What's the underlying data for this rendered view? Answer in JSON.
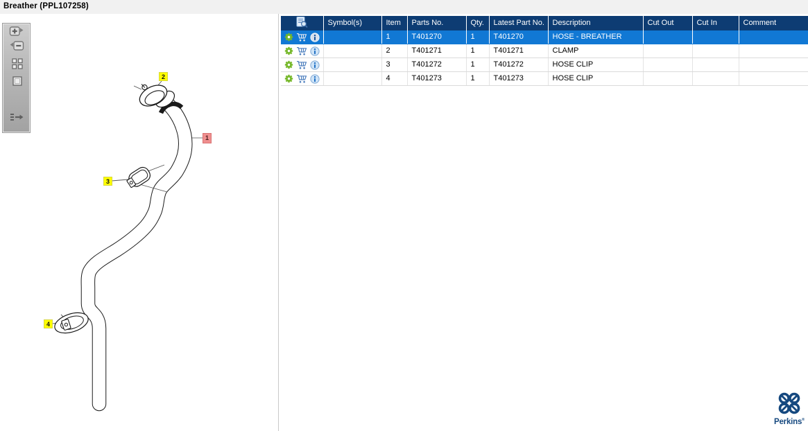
{
  "title": "Breather (PPL107258)",
  "toolbar": {
    "buttons": [
      {
        "name": "zoom-in"
      },
      {
        "name": "zoom-out"
      },
      {
        "name": "thumbnail-view"
      },
      {
        "name": "fit-view"
      },
      {
        "name": "toggle-parts-list"
      }
    ]
  },
  "table": {
    "columns": [
      "",
      "Symbol(s)",
      "Item",
      "Parts No.",
      "Qty.",
      "Latest Part No.",
      "Description",
      "Cut Out",
      "Cut In",
      "Comment"
    ],
    "rows": [
      {
        "symbols": "",
        "item": "1",
        "parts_no": "T401270",
        "qty": "1",
        "latest_part_no": "T401270",
        "description": "HOSE - BREATHER",
        "cut_out": "",
        "cut_in": "",
        "comment": "",
        "selected": true
      },
      {
        "symbols": "",
        "item": "2",
        "parts_no": "T401271",
        "qty": "1",
        "latest_part_no": "T401271",
        "description": "CLAMP",
        "cut_out": "",
        "cut_in": "",
        "comment": "",
        "selected": false
      },
      {
        "symbols": "",
        "item": "3",
        "parts_no": "T401272",
        "qty": "1",
        "latest_part_no": "T401272",
        "description": "HOSE CLIP",
        "cut_out": "",
        "cut_in": "",
        "comment": "",
        "selected": false
      },
      {
        "symbols": "",
        "item": "4",
        "parts_no": "T401273",
        "qty": "1",
        "latest_part_no": "T401273",
        "description": "HOSE CLIP",
        "cut_out": "",
        "cut_in": "",
        "comment": "",
        "selected": false
      }
    ]
  },
  "diagram": {
    "callouts": [
      {
        "label": "1",
        "state": "selected"
      },
      {
        "label": "2",
        "state": "normal"
      },
      {
        "label": "3",
        "state": "normal"
      },
      {
        "label": "4",
        "state": "normal"
      }
    ]
  },
  "branding": {
    "name": "Perkins",
    "mark": "®"
  },
  "colors": {
    "header_bg": "#0d3c73",
    "selected_row_bg": "#1178d4",
    "callout_normal": "#ffff00",
    "callout_selected": "#ef8f8f",
    "gear_green": "#76b82a",
    "cart_blue": "#4d7fbe",
    "info_blue": "#1f6fc4",
    "logo_navy": "#15487f"
  }
}
